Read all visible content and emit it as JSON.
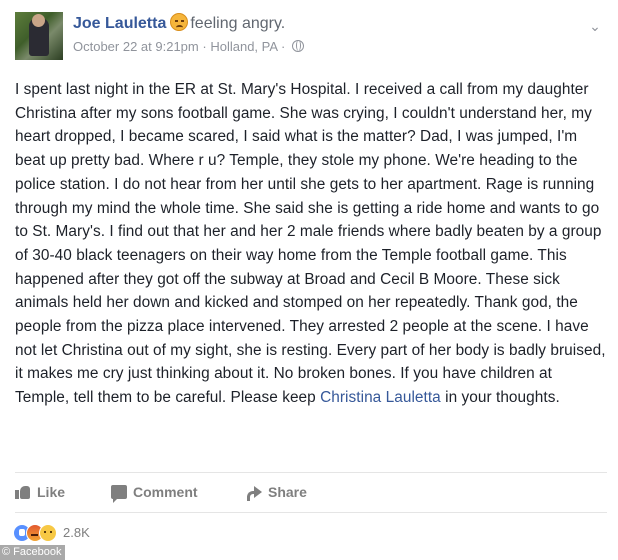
{
  "post": {
    "author": "Joe Lauletta",
    "feeling": "feeling angry.",
    "feeling_icon": "angry-face-icon",
    "timestamp": "October 22 at 9:21pm",
    "separator": "·",
    "location": "Holland, PA",
    "separator2": "·",
    "privacy_icon": "globe-icon",
    "body_before_tag": "I spent last night in the ER at St. Mary's Hospital. I received a call from my daughter Christina after my sons football game. She was crying, I couldn't understand her, my heart dropped, I became scared, I said what is the matter? Dad, I was jumped, I'm beat up pretty bad. Where r u? Temple, they stole my phone. We're heading to the police station. I do not hear from her until she gets to her apartment. Rage is running through my mind the whole time. She said she is getting a ride home and wants to go to St. Mary's. I find out that her and her 2 male friends where badly beaten by a group of 30-40 black teenagers on their way home from the Temple football game. This happened after they got off the subway at Broad and Cecil B Moore. These sick animals held her down and kicked and stomped on her repeatedly. Thank god, the people from the pizza place intervened. They arrested 2 people at the scene. I have not let Christina out of my sight, she is resting. Every part of her body is badly bruised, it makes me cry just thinking about it. No broken bones. If you have children at Temple, tell them to be careful. Please keep ",
    "tagged_person": "Christina Lauletta",
    "body_after_tag": " in your thoughts."
  },
  "actions": {
    "like": "Like",
    "comment": "Comment",
    "share": "Share"
  },
  "reactions": {
    "icons": [
      "like-reaction-icon",
      "angry-reaction-icon",
      "sad-reaction-icon"
    ],
    "count": "2.8K"
  },
  "watermark": "© Facebook",
  "colors": {
    "link": "#365899",
    "text": "#1d2129",
    "meta": "#90949c",
    "action": "#7f7f7f"
  }
}
